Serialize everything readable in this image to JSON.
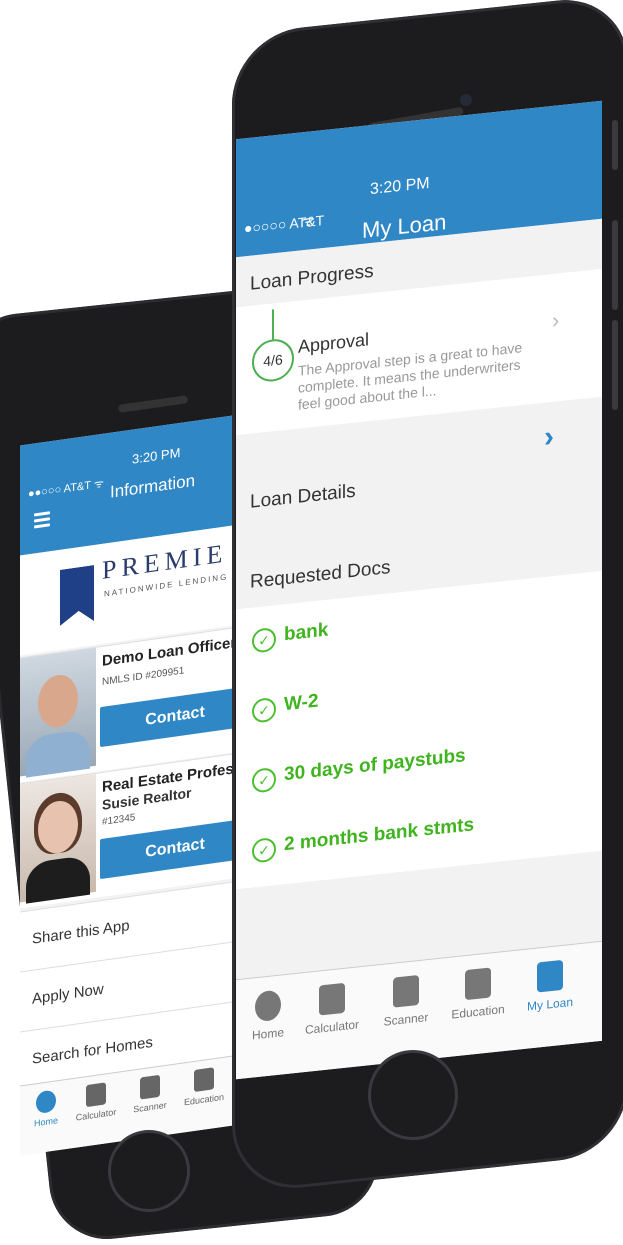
{
  "back_phone": {
    "status": {
      "carrier": "●●○○○ AT&T ᯤ",
      "time": "3:20 PM"
    },
    "header_title": "Information",
    "logo": {
      "word": "PREMIE",
      "sub": "NATIONWIDE LENDING"
    },
    "loan_officer": {
      "name": "Demo Loan Officer",
      "id": "NMLS ID #209951",
      "contact_label": "Contact"
    },
    "realtor": {
      "role": "Real Estate Profess",
      "name": "Susie Realtor",
      "id": "#12345",
      "contact_label": "Contact"
    },
    "menu": [
      "Share this App",
      "Apply Now",
      "Search for Homes"
    ],
    "tabs": [
      {
        "label": "Home",
        "icon": "info-icon",
        "active": true
      },
      {
        "label": "Calculator",
        "icon": "calculator-icon",
        "active": false
      },
      {
        "label": "Scanner",
        "icon": "scanner-icon",
        "active": false
      },
      {
        "label": "Education",
        "icon": "education-icon",
        "active": false
      }
    ]
  },
  "front_phone": {
    "status": {
      "carrier": "●○○○○ AT&T",
      "wifi": "ᯤ",
      "time": "3:20 PM"
    },
    "header_title": "My Loan",
    "loan_progress": {
      "heading": "Loan Progress",
      "step": "4/6",
      "step_title": "Approval",
      "step_desc": "The Approval step is a great to have complete.  It means the underwriters feel good about the l..."
    },
    "loan_details": {
      "heading": "Loan Details"
    },
    "requested_docs": {
      "heading": "Requested Docs",
      "items": [
        "bank",
        "W-2",
        "30 days of paystubs",
        "2 months bank stmts"
      ]
    },
    "tabs": [
      {
        "label": "Home",
        "icon": "info-icon",
        "active": false
      },
      {
        "label": "Calculator",
        "icon": "calculator-icon",
        "active": false
      },
      {
        "label": "Scanner",
        "icon": "scanner-icon",
        "active": false
      },
      {
        "label": "Education",
        "icon": "education-icon",
        "active": false
      },
      {
        "label": "My Loan",
        "icon": "my-loan-icon",
        "active": true
      }
    ]
  },
  "colors": {
    "brand_blue": "#2f87c6",
    "check_green": "#3fb41f",
    "phone_body": "#1c1c1f"
  }
}
